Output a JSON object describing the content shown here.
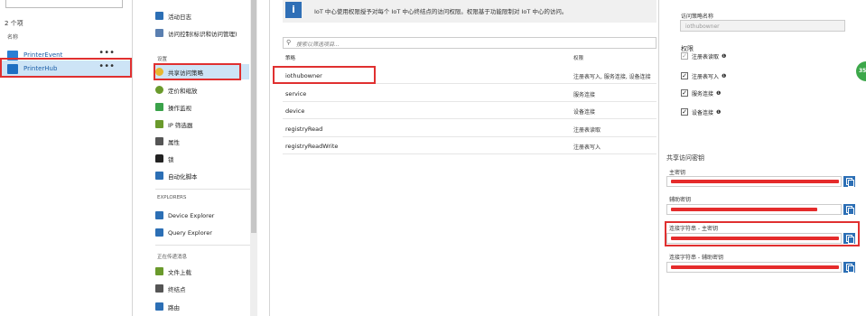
{
  "left_pane": {
    "count": "2 个项",
    "column_header": "名称",
    "items": [
      {
        "label": "PrinterEvent",
        "more": "•••",
        "color": "#2a7fd4"
      },
      {
        "label": "PrinterHub",
        "more": "•••",
        "color": "#1f6fc2"
      }
    ]
  },
  "nav": {
    "items": [
      {
        "label": "活动日志",
        "icon": "activity-log-icon",
        "color": "#2c6fb5"
      },
      {
        "label": "访问控制(标识和访问管理)",
        "icon": "access-control-icon",
        "color": "#5a7fb0"
      },
      {
        "label": "共享访问策略",
        "icon": "key-icon",
        "color": "#e8b730"
      },
      {
        "label": "定价和缩放",
        "icon": "pricing-icon",
        "color": "#6a9a2c"
      },
      {
        "label": "操作监视",
        "icon": "monitor-icon",
        "color": "#3aa24a"
      },
      {
        "label": "IP 筛选器",
        "icon": "ip-filter-icon",
        "color": "#6a9a2c"
      },
      {
        "label": "属性",
        "icon": "properties-icon",
        "color": "#555555"
      },
      {
        "label": "锁",
        "icon": "lock-icon",
        "color": "#222222"
      },
      {
        "label": "自动化脚本",
        "icon": "automation-script-icon",
        "color": "#2c6fb5"
      },
      {
        "label": "Device Explorer",
        "icon": "device-explorer-icon",
        "color": "#2c6fb5"
      },
      {
        "label": "Query Explorer",
        "icon": "query-explorer-icon",
        "color": "#2c6fb5"
      },
      {
        "label": "文件上载",
        "icon": "file-upload-icon",
        "color": "#6a9a2c"
      },
      {
        "label": "终结点",
        "icon": "endpoint-icon",
        "color": "#555555"
      },
      {
        "label": "路由",
        "icon": "route-icon",
        "color": "#2c6fb5"
      }
    ],
    "sections": {
      "settings": "设置",
      "explorers": "EXPLORERS",
      "messaging": "正在传递消息"
    }
  },
  "main": {
    "info_text": "IoT 中心使用权限授予对每个 IoT 中心终结点的访问权限。权限基于功能限制对 IoT 中心的访问。",
    "search_placeholder": "搜索以筛选项目...",
    "col_policy": "策略",
    "col_permission": "权限",
    "rows": [
      {
        "policy": "iothubowner",
        "permission": "注册表写入, 服务连接, 设备连接"
      },
      {
        "policy": "service",
        "permission": "服务连接"
      },
      {
        "policy": "device",
        "permission": "设备连接"
      },
      {
        "policy": "registryRead",
        "permission": "注册表读取"
      },
      {
        "policy": "registryReadWrite",
        "permission": "注册表写入"
      }
    ]
  },
  "details": {
    "name_label": "访问策略名称",
    "name_value": "iothubowner",
    "perm_title": "权限",
    "permissions": [
      {
        "label": "注册表读取",
        "checked": true
      },
      {
        "label": "注册表写入",
        "checked": true
      },
      {
        "label": "服务连接",
        "checked": true
      },
      {
        "label": "设备连接",
        "checked": true
      }
    ],
    "keys_title": "共享访问密钥",
    "primary_key_label": "主密钥",
    "secondary_key_label": "辅助密钥",
    "conn_primary_label": "连接字符串 - 主密钥",
    "conn_secondary_label": "连接字符串 - 辅助密钥",
    "info_mark": "❶",
    "badge": "35"
  },
  "colors": {
    "accent": "#2c6fb5",
    "highlight": "#cde4f6",
    "callout": "#e03030",
    "redaction": "#e52b2b"
  }
}
